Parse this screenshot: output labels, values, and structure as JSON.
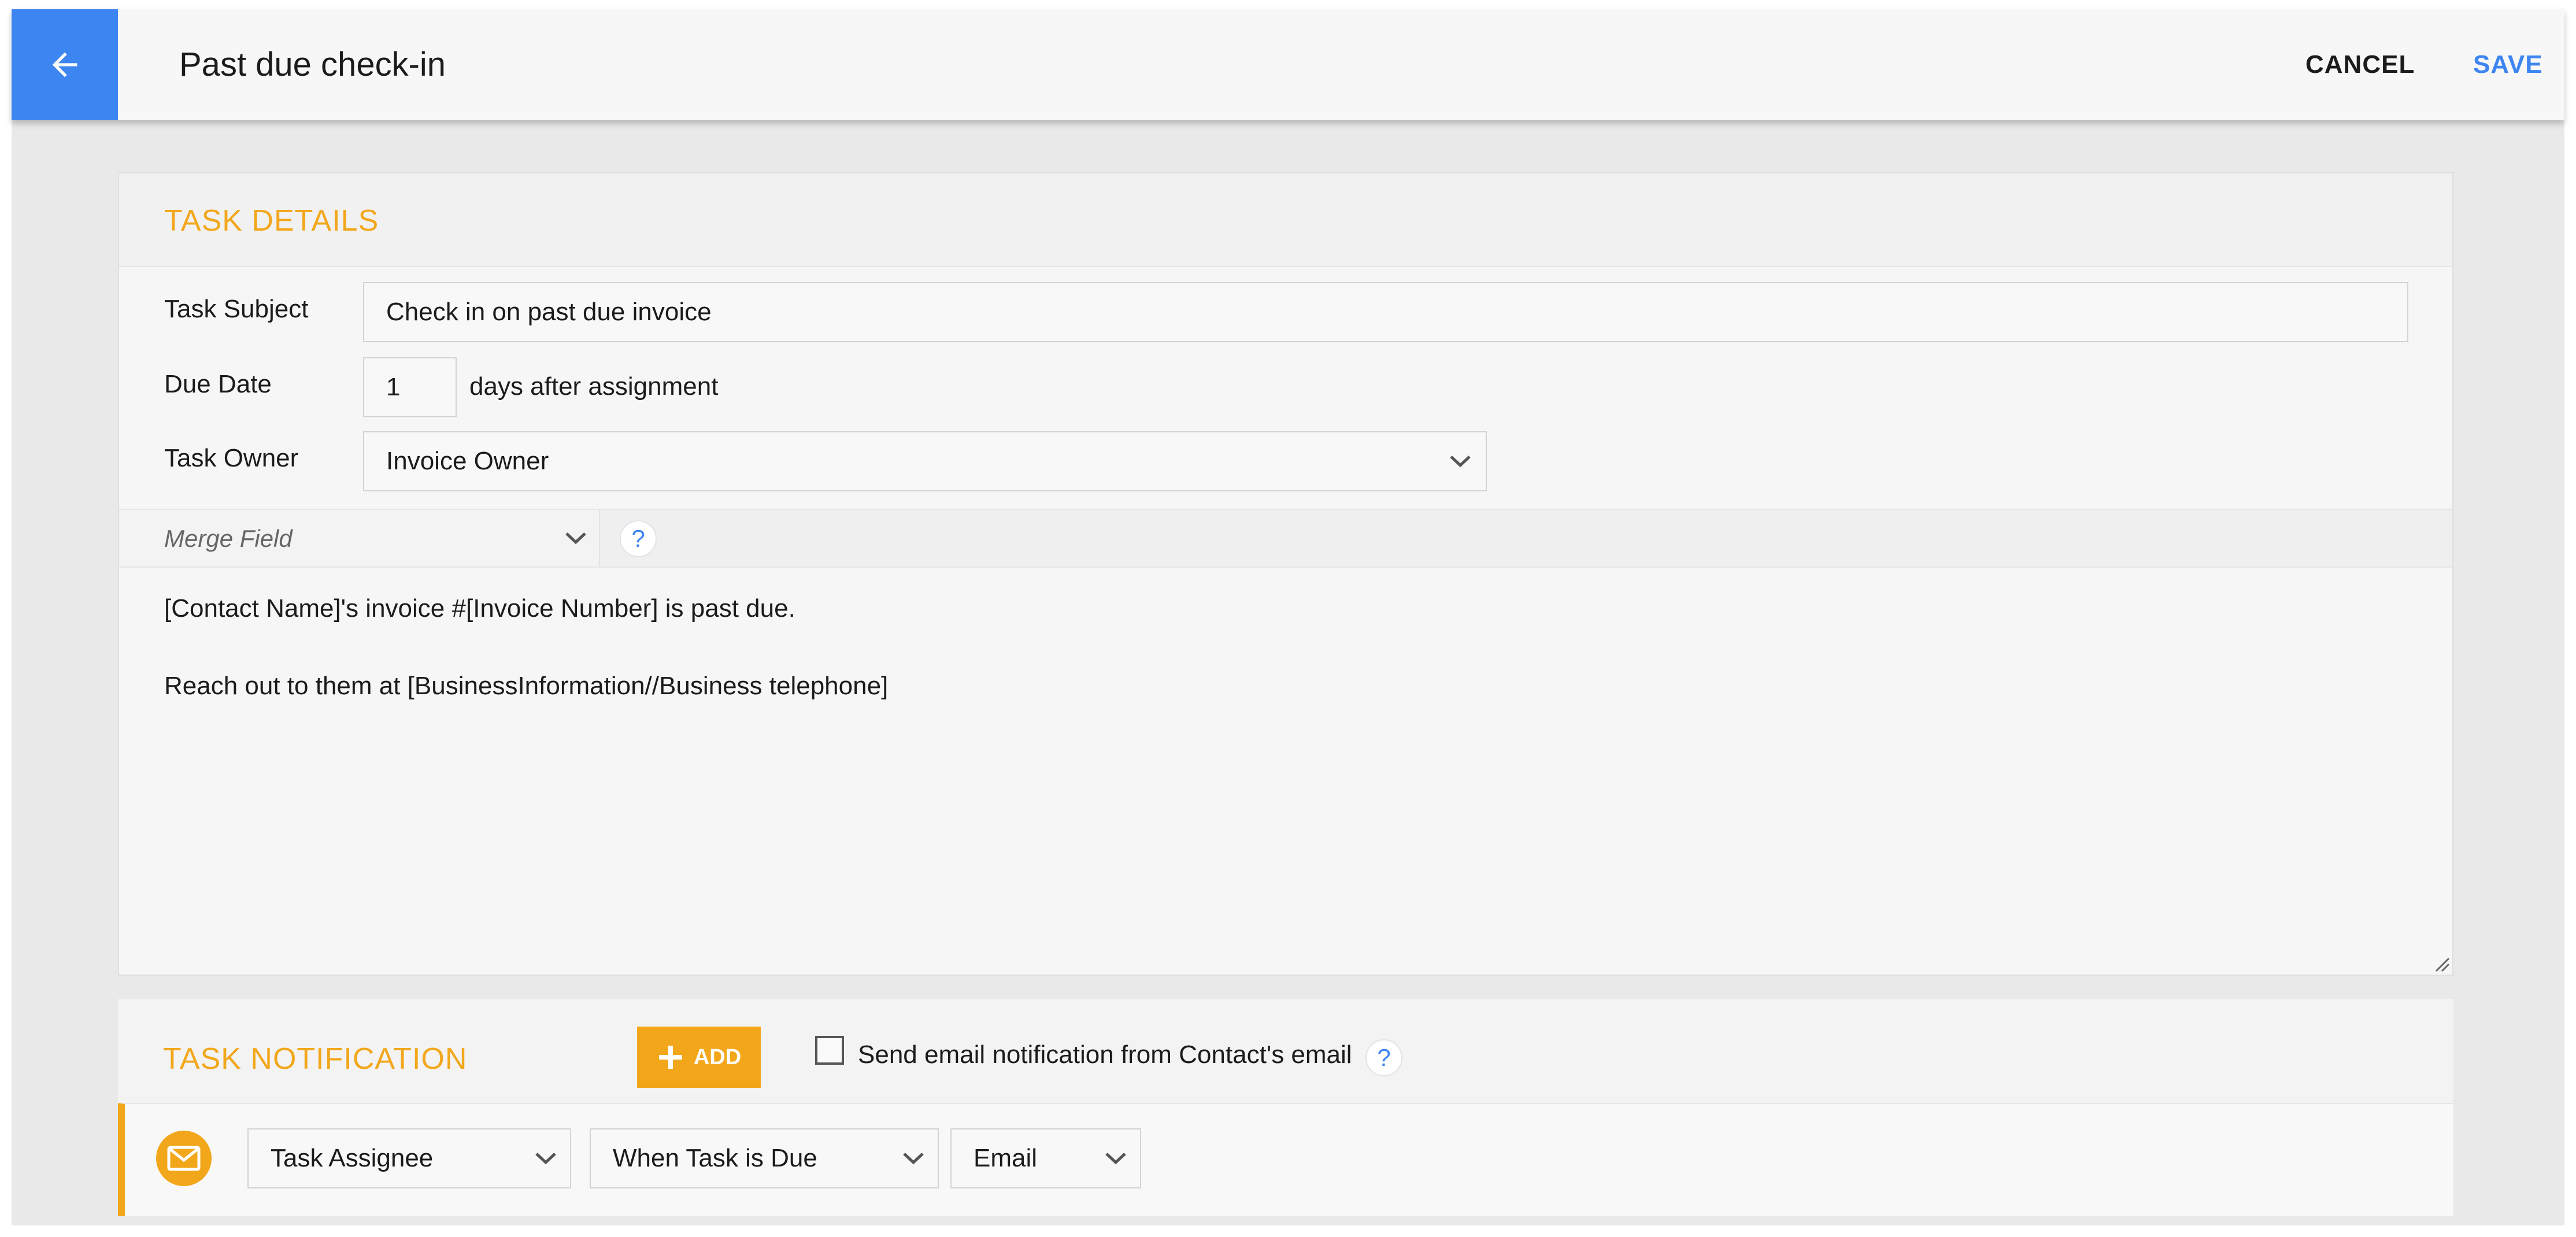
{
  "header": {
    "title": "Past due check-in",
    "cancel_label": "CANCEL",
    "save_label": "SAVE",
    "back_icon": "arrow-left-icon"
  },
  "task_details": {
    "section_title": "TASK DETAILS",
    "subject_label": "Task Subject",
    "subject_value": "Check in on past due invoice",
    "due_date_label": "Due Date",
    "due_date_value": "1",
    "due_date_suffix": "days after assignment",
    "owner_label": "Task Owner",
    "owner_value": "Invoice Owner",
    "merge_field_placeholder": "Merge Field",
    "help_symbol": "?",
    "body_line_1": "[Contact Name]'s invoice #[Invoice Number] is past due.",
    "body_line_2": "Reach out to them at [BusinessInformation//Business telephone]"
  },
  "task_notification": {
    "section_title": "TASK NOTIFICATION",
    "add_label": "ADD",
    "checkbox_label": "Send email notification from Contact's email",
    "checkbox_checked": false,
    "help_symbol": "?",
    "row": {
      "icon": "envelope-icon",
      "recipient": "Task Assignee",
      "timing": "When Task is Due",
      "method": "Email"
    }
  },
  "colors": {
    "accent_blue": "#3d85f0",
    "accent_orange": "#f2a71b"
  }
}
